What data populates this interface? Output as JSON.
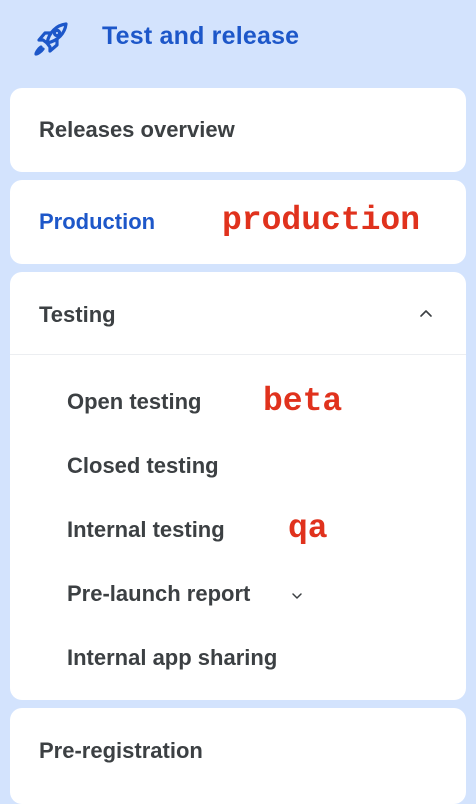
{
  "header": {
    "title": "Test and release",
    "icon": "rocket-icon",
    "accent_color": "#1d57c9"
  },
  "nav": {
    "releases_overview": "Releases overview",
    "production": {
      "label": "Production",
      "annotation": "production"
    },
    "testing": {
      "label": "Testing",
      "expanded": true,
      "items": [
        {
          "label": "Open testing",
          "annotation": "beta"
        },
        {
          "label": "Closed testing"
        },
        {
          "label": "Internal testing",
          "annotation": "qa"
        },
        {
          "label": "Pre-launch report",
          "has_submenu": true
        },
        {
          "label": "Internal app sharing"
        }
      ]
    },
    "pre_registration": "Pre-registration"
  },
  "colors": {
    "background": "#d3e3fd",
    "card": "#ffffff",
    "text": "#3c4043",
    "active": "#1d57c9",
    "annotation": "#e0321d"
  }
}
